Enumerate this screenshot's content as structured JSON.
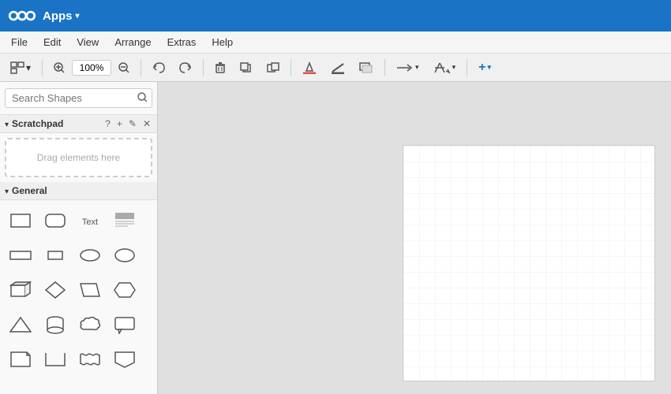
{
  "topbar": {
    "logo_alt": "Nextcloud logo",
    "apps_label": "Apps",
    "chevron": "▾"
  },
  "menubar": {
    "items": [
      {
        "label": "File"
      },
      {
        "label": "Edit"
      },
      {
        "label": "View"
      },
      {
        "label": "Arrange"
      },
      {
        "label": "Extras"
      },
      {
        "label": "Help"
      }
    ]
  },
  "toolbar": {
    "zoom_value": "100%",
    "zoom_icon_in": "+",
    "zoom_icon_out": "−",
    "undo_label": "↩",
    "redo_label": "↪",
    "delete_label": "⊠",
    "duplicate_label": "⧉",
    "duplicate2_label": "⧉",
    "fill_label": "⬟",
    "line_label": "╱",
    "shadow_label": "▭",
    "connector_label": "→",
    "waypoint_label": "⤢",
    "add_label": "+"
  },
  "sidebar": {
    "search_placeholder": "Search Shapes",
    "search_icon": "🔍",
    "scratchpad": {
      "title": "Scratchpad",
      "help": "?",
      "add": "+",
      "edit": "✎",
      "close": "✕",
      "drag_hint": "Drag elements here"
    },
    "general": {
      "title": "General"
    }
  },
  "shapes": {
    "rows": [
      [
        "rect",
        "rounded-rect",
        "text",
        "heading"
      ],
      [
        "rect-wide",
        "rect-small",
        "stadium",
        "ellipse"
      ],
      [
        "rect-3d",
        "diamond",
        "parallelogram",
        "hexagon"
      ],
      [
        "triangle",
        "cylinder",
        "cloud",
        "callout"
      ],
      [
        "rect-fold",
        "rect-open",
        "wavy",
        "pentagon-down"
      ]
    ]
  },
  "canvas": {
    "grid_visible": true
  }
}
